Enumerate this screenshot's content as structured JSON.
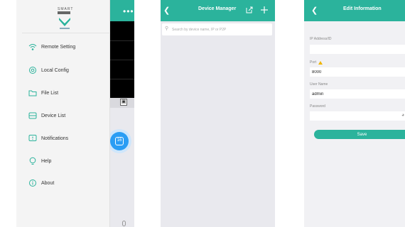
{
  "colors": {
    "accent": "#2bb39c",
    "app_bg": "#e9e9ee",
    "drawer_bg": "#f4f4f4",
    "fab": "#2a9df4",
    "warning": "#f0b400"
  },
  "panel1": {
    "header_more": "•••",
    "brand_line": "SMART",
    "menu": [
      {
        "label": "Remote Setting",
        "icon": "wifi-gear-icon"
      },
      {
        "label": "Local Config",
        "icon": "gear-icon"
      },
      {
        "label": "File List",
        "icon": "folder-icon"
      },
      {
        "label": "Device List",
        "icon": "device-list-icon"
      },
      {
        "label": "Notifications",
        "icon": "notification-icon"
      },
      {
        "label": "Help",
        "icon": "bulb-icon"
      },
      {
        "label": "About",
        "icon": "info-icon"
      }
    ]
  },
  "panel2": {
    "title": "Device Manager",
    "search_placeholder": "Search by device name, IP or P2P"
  },
  "panel3": {
    "title": "Edit Information",
    "fields": [
      {
        "label": "IP Address/ID",
        "value": ""
      },
      {
        "label": "Port",
        "value": "8000"
      },
      {
        "label": "User Name",
        "value": "admin"
      },
      {
        "label": "Password",
        "value": ""
      }
    ],
    "save_label": "Save"
  }
}
